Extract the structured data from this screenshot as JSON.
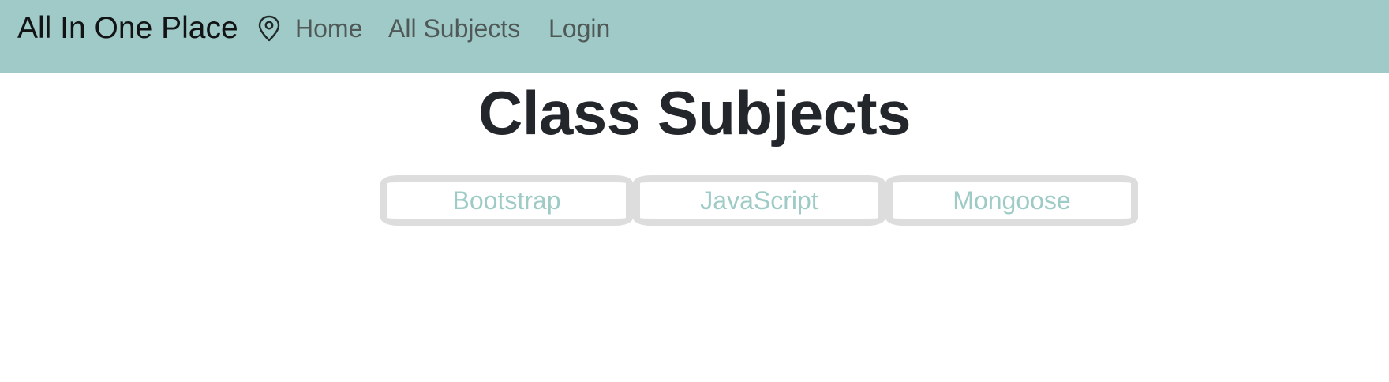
{
  "navbar": {
    "brand": "All In One Place",
    "pin_icon": "map-pin-icon",
    "links": [
      {
        "label": "Home"
      },
      {
        "label": "All Subjects"
      },
      {
        "label": "Login"
      }
    ]
  },
  "main": {
    "title": "Class Subjects",
    "subjects": [
      {
        "label": "Bootstrap"
      },
      {
        "label": "JavaScript"
      },
      {
        "label": "Mongoose"
      }
    ]
  },
  "colors": {
    "navbar_bg": "#a0cac7",
    "subject_text": "#9ecbc6",
    "card_border": "#dddddd",
    "title_text": "#23262b"
  }
}
